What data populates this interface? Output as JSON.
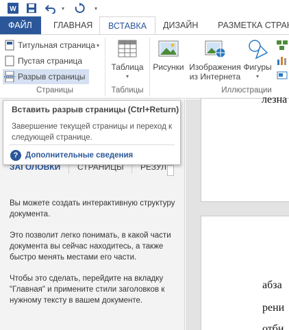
{
  "quick_access": {
    "icons": [
      "word-logo-icon",
      "save-icon",
      "undo-icon",
      "redo-icon"
    ]
  },
  "tabs": [
    {
      "label": "ФАЙЛ"
    },
    {
      "label": "ГЛАВНАЯ"
    },
    {
      "label": "ВСТАВКА"
    },
    {
      "label": "ДИЗАЙН"
    },
    {
      "label": "РАЗМЕТКА СТРАНИ"
    }
  ],
  "ribbon": {
    "pages_group": {
      "cover_page": "Титульная страница",
      "blank_page": "Пустая страница",
      "page_break": "Разрыв страницы",
      "label": "Страницы"
    },
    "tables_group": {
      "table": "Таблица",
      "label": "Таблицы"
    },
    "illustrations_group": {
      "pictures": "Рисунки",
      "online_pictures_line1": "Изображения",
      "online_pictures_line2": "из Интернета",
      "shapes": "Фигуры",
      "label": "Иллюстрации"
    }
  },
  "tooltip": {
    "title": "Вставить разрыв страницы (Ctrl+Return)",
    "description": "Завершение текущей страницы и переход к следующей странице.",
    "help_link": "Дополнительные сведения"
  },
  "nav_pane": {
    "tabs": [
      "ЗАГОЛОВКИ",
      "СТРАНИЦЫ",
      "РЕЗУЛЬ"
    ],
    "paragraphs": [
      "Вы можете создать интерактивную структуру документа.",
      "Это позволит легко понимать, в какой части документа вы сейчас находитесь, а также быстро менять местами его части.",
      "Чтобы это сделать, перейдите на вкладку \"Главная\" и примените стили заголовков к нужному тексту в вашем документе."
    ]
  },
  "document": {
    "page1_text": "лезна",
    "page2_lines": [
      "абза",
      "рени",
      "отби"
    ]
  },
  "colors": {
    "accent": "#2b579a",
    "hover": "#d5e1f2"
  }
}
